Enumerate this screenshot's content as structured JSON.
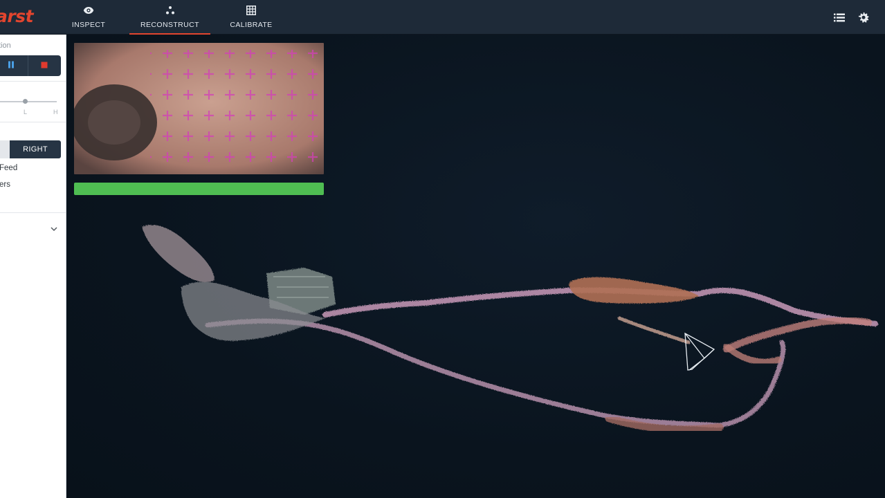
{
  "app": {
    "logo_text": "arst"
  },
  "nav": {
    "tabs": [
      {
        "label": "INSPECT",
        "icon": "eye-icon",
        "active": false
      },
      {
        "label": "RECONSTRUCT",
        "icon": "nodes-icon",
        "active": true
      },
      {
        "label": "CALIBRATE",
        "icon": "grid-icon",
        "active": false
      }
    ],
    "accent_color": "#e2452e"
  },
  "toolbar_right": {
    "icons": [
      "list-icon",
      "settings-gear-icon"
    ]
  },
  "sidebar": {
    "section_title": "tion",
    "controls": {
      "pause_icon": "pause-icon",
      "stop_icon": "stop-icon"
    },
    "slider": {
      "ticks": [
        "L",
        "H"
      ]
    },
    "camera_select": {
      "selected": "RIGHT"
    },
    "options": [
      "Feed",
      "ers"
    ],
    "collapse_icon": "chevron-down-icon"
  },
  "viewport": {
    "progress_percent": 100,
    "progress_color": "#4fbd52"
  }
}
